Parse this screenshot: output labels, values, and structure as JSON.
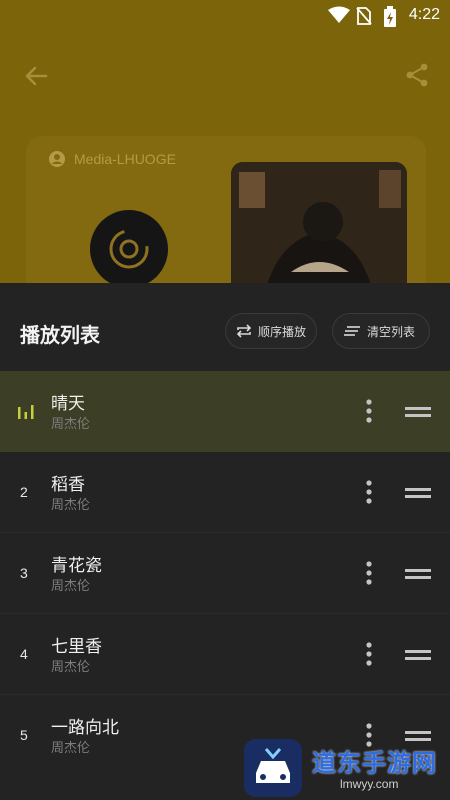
{
  "status_bar": {
    "time": "4:22"
  },
  "background_app": {
    "media_source": "Media-LHUOGE"
  },
  "playlist": {
    "title": "播放列表",
    "order_button": "顺序播放",
    "clear_button": "清空列表",
    "items": [
      {
        "index": "",
        "song": "晴天",
        "artist": "周杰伦",
        "playing": true
      },
      {
        "index": "2",
        "song": "稻香",
        "artist": "周杰伦",
        "playing": false
      },
      {
        "index": "3",
        "song": "青花瓷",
        "artist": "周杰伦",
        "playing": false
      },
      {
        "index": "4",
        "song": "七里香",
        "artist": "周杰伦",
        "playing": false
      },
      {
        "index": "5",
        "song": "一路向北",
        "artist": "周杰伦",
        "playing": false
      }
    ]
  },
  "watermark": {
    "name": "道东手游网",
    "url": "lmwyy.com"
  },
  "colors": {
    "background_dim": "#7c640b",
    "sheet": "#232323",
    "active_row": "#3c3e26",
    "accent": "#c9cf3a"
  }
}
